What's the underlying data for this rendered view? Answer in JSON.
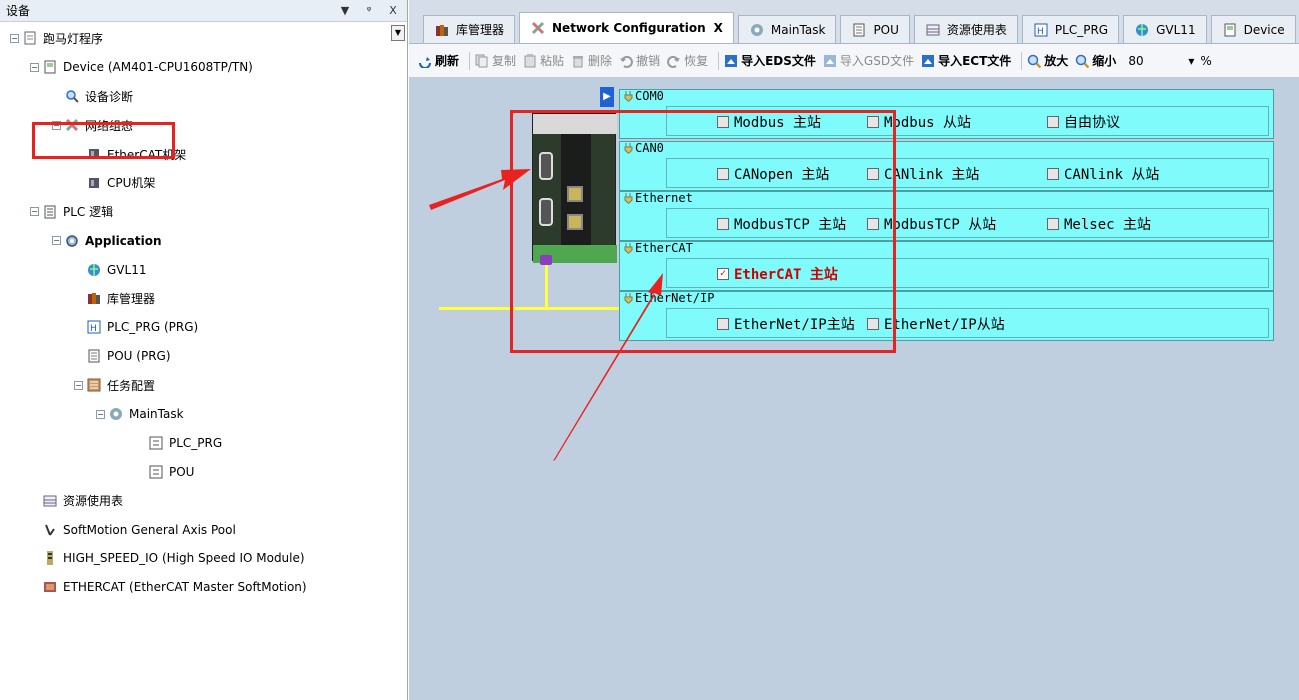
{
  "left_panel": {
    "title": "设备",
    "buttons": {
      "dropdown": "▼",
      "pin": "ᵠ",
      "close": "X"
    },
    "tree": [
      {
        "label": "跑马灯程序",
        "depth": 0,
        "icon": "project-icon",
        "expander": "−",
        "style": "italic"
      },
      {
        "label": "Device (AM401-CPU1608TP/TN)",
        "depth": 1,
        "icon": "device-icon",
        "expander": "−"
      },
      {
        "label": "设备诊断",
        "depth": 2,
        "icon": "diagnosis-icon"
      },
      {
        "label": "网络组态",
        "depth": 2,
        "icon": "network-config-icon",
        "expander": "−"
      },
      {
        "label": "EtherCAT机架",
        "depth": 3,
        "icon": "rack-icon"
      },
      {
        "label": "CPU机架",
        "depth": 3,
        "icon": "rack-icon"
      },
      {
        "label": "PLC 逻辑",
        "depth": 1,
        "icon": "plc-logic-icon",
        "expander": "−"
      },
      {
        "label": "Application",
        "depth": 2,
        "icon": "application-icon",
        "expander": "−",
        "style": "bold"
      },
      {
        "label": "GVL11",
        "depth": 3,
        "icon": "globe-icon"
      },
      {
        "label": "库管理器",
        "depth": 3,
        "icon": "library-icon"
      },
      {
        "label": "PLC_PRG (PRG)",
        "depth": 3,
        "icon": "program-icon"
      },
      {
        "label": "POU (PRG)",
        "depth": 3,
        "icon": "pou-icon"
      },
      {
        "label": "任务配置",
        "depth": 3,
        "icon": "task-config-icon",
        "expander": "−"
      },
      {
        "label": "MainTask",
        "depth": 4,
        "icon": "task-icon",
        "expander": "−"
      },
      {
        "label": "PLC_PRG",
        "depth": 5,
        "icon": "call-icon"
      },
      {
        "label": "POU",
        "depth": 5,
        "icon": "call-icon"
      },
      {
        "label": "资源使用表",
        "depth": 1,
        "icon": "table-icon"
      },
      {
        "label": "SoftMotion General Axis Pool",
        "depth": 1,
        "icon": "axis-icon"
      },
      {
        "label": "HIGH_SPEED_IO (High Speed IO Module)",
        "depth": 1,
        "icon": "io-module-icon"
      },
      {
        "label": "ETHERCAT (EtherCAT Master SoftMotion)",
        "depth": 1,
        "icon": "ethercat-master-icon"
      }
    ],
    "dropdown_glyph": "▼"
  },
  "tabs": [
    {
      "label": "库管理器",
      "icon": "library-icon",
      "active": false
    },
    {
      "label": "Network Configuration",
      "icon": "network-config-icon",
      "active": true,
      "close": "X"
    },
    {
      "label": "MainTask",
      "icon": "task-icon",
      "active": false
    },
    {
      "label": "POU",
      "icon": "pou-icon",
      "active": false
    },
    {
      "label": "资源使用表",
      "icon": "table-icon",
      "active": false
    },
    {
      "label": "PLC_PRG",
      "icon": "program-icon",
      "active": false
    },
    {
      "label": "GVL11",
      "icon": "globe-icon",
      "active": false
    },
    {
      "label": "Device",
      "icon": "device-icon",
      "active": false
    }
  ],
  "toolbar": {
    "refresh": "刷新",
    "copy": "复制",
    "paste": "粘贴",
    "delete": "删除",
    "undo": "撤销",
    "redo": "恢复",
    "import_eds": "导入EDS文件",
    "import_gsd": "导入GSD文件",
    "import_ect": "导入ECT文件",
    "zoom_in": "放大",
    "zoom_out": "缩小",
    "zoom_value": "80",
    "zoom_unit": "%",
    "zoom_caret": "▾"
  },
  "canvas": {
    "expand_glyph": "▶",
    "groups": [
      {
        "title": "COM0",
        "options": [
          {
            "label": "Modbus 主站",
            "checked": false
          },
          {
            "label": "Modbus 从站",
            "checked": false
          },
          {
            "label": "自由协议",
            "checked": false
          }
        ]
      },
      {
        "title": "CAN0",
        "options": [
          {
            "label": "CANopen 主站",
            "checked": false
          },
          {
            "label": "CANlink 主站",
            "checked": false
          },
          {
            "label": "CANlink 从站",
            "checked": false
          }
        ]
      },
      {
        "title": "Ethernet",
        "options": [
          {
            "label": "ModbusTCP 主站",
            "checked": false
          },
          {
            "label": "ModbusTCP 从站",
            "checked": false
          },
          {
            "label": "Melsec 主站",
            "checked": false
          }
        ]
      },
      {
        "title": "EtherCAT",
        "options": [
          {
            "label": "EtherCAT 主站",
            "checked": true
          }
        ]
      },
      {
        "title": "EtherNet/IP",
        "options": [
          {
            "label": "EtherNet/IP主站",
            "checked": false
          },
          {
            "label": "EtherNet/IP从站",
            "checked": false
          }
        ]
      }
    ],
    "check_mark": "✓"
  },
  "colors": {
    "annotation": "#e8231f",
    "group_bg": "#7ffbfb",
    "canvas_bg": "#bfcfe0",
    "bus": "#ffff44"
  }
}
